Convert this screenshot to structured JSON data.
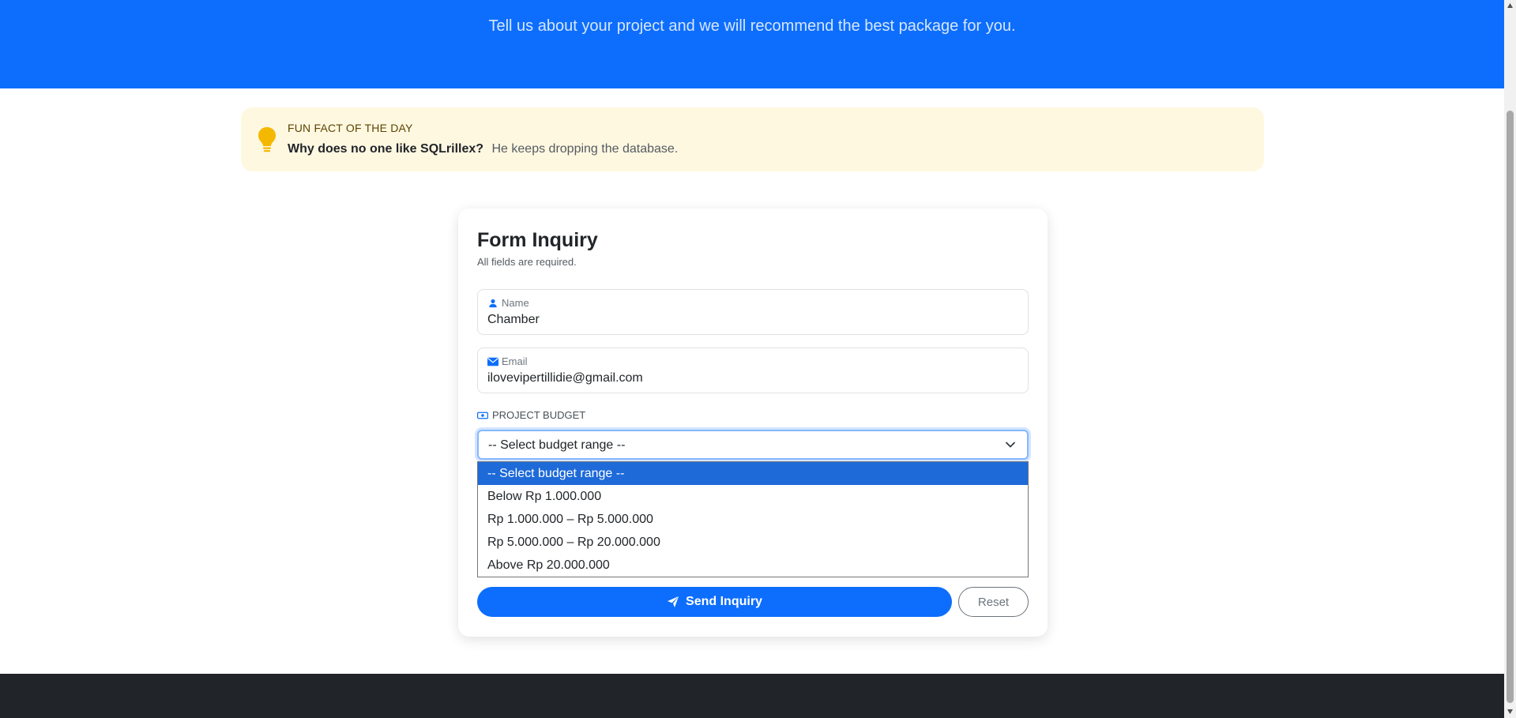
{
  "hero": {
    "subtitle": "Tell us about your project and we will recommend the best package for you."
  },
  "fun_fact": {
    "kicker": "FUN FACT OF THE DAY",
    "question": "Why does no one like SQLrillex?",
    "answer": "He keeps dropping the database.",
    "icon": "lightbulb-icon",
    "accent_color": "#f5b800"
  },
  "form": {
    "title": "Form Inquiry",
    "subtitle": "All fields are required.",
    "name": {
      "label": "Name",
      "value": "Chamber",
      "icon": "person-icon"
    },
    "email": {
      "label": "Email",
      "value": "ilovevipertillidie@gmail.com",
      "icon": "envelope-icon"
    },
    "budget": {
      "label": "PROJECT BUDGET",
      "icon": "cash-icon",
      "selected": "-- Select budget range --",
      "options": [
        "-- Select budget range --",
        "Below Rp 1.000.000",
        "Rp 1.000.000 – Rp 5.000.000",
        "Rp 5.000.000 – Rp 20.000.000",
        "Above Rp 20.000.000"
      ]
    },
    "send_label": "Send Inquiry",
    "reset_label": "Reset"
  },
  "colors": {
    "primary": "#0d6efd",
    "footer": "#212529",
    "funfact_bg": "#fff8e1",
    "option_highlight": "#1e6ad8"
  }
}
